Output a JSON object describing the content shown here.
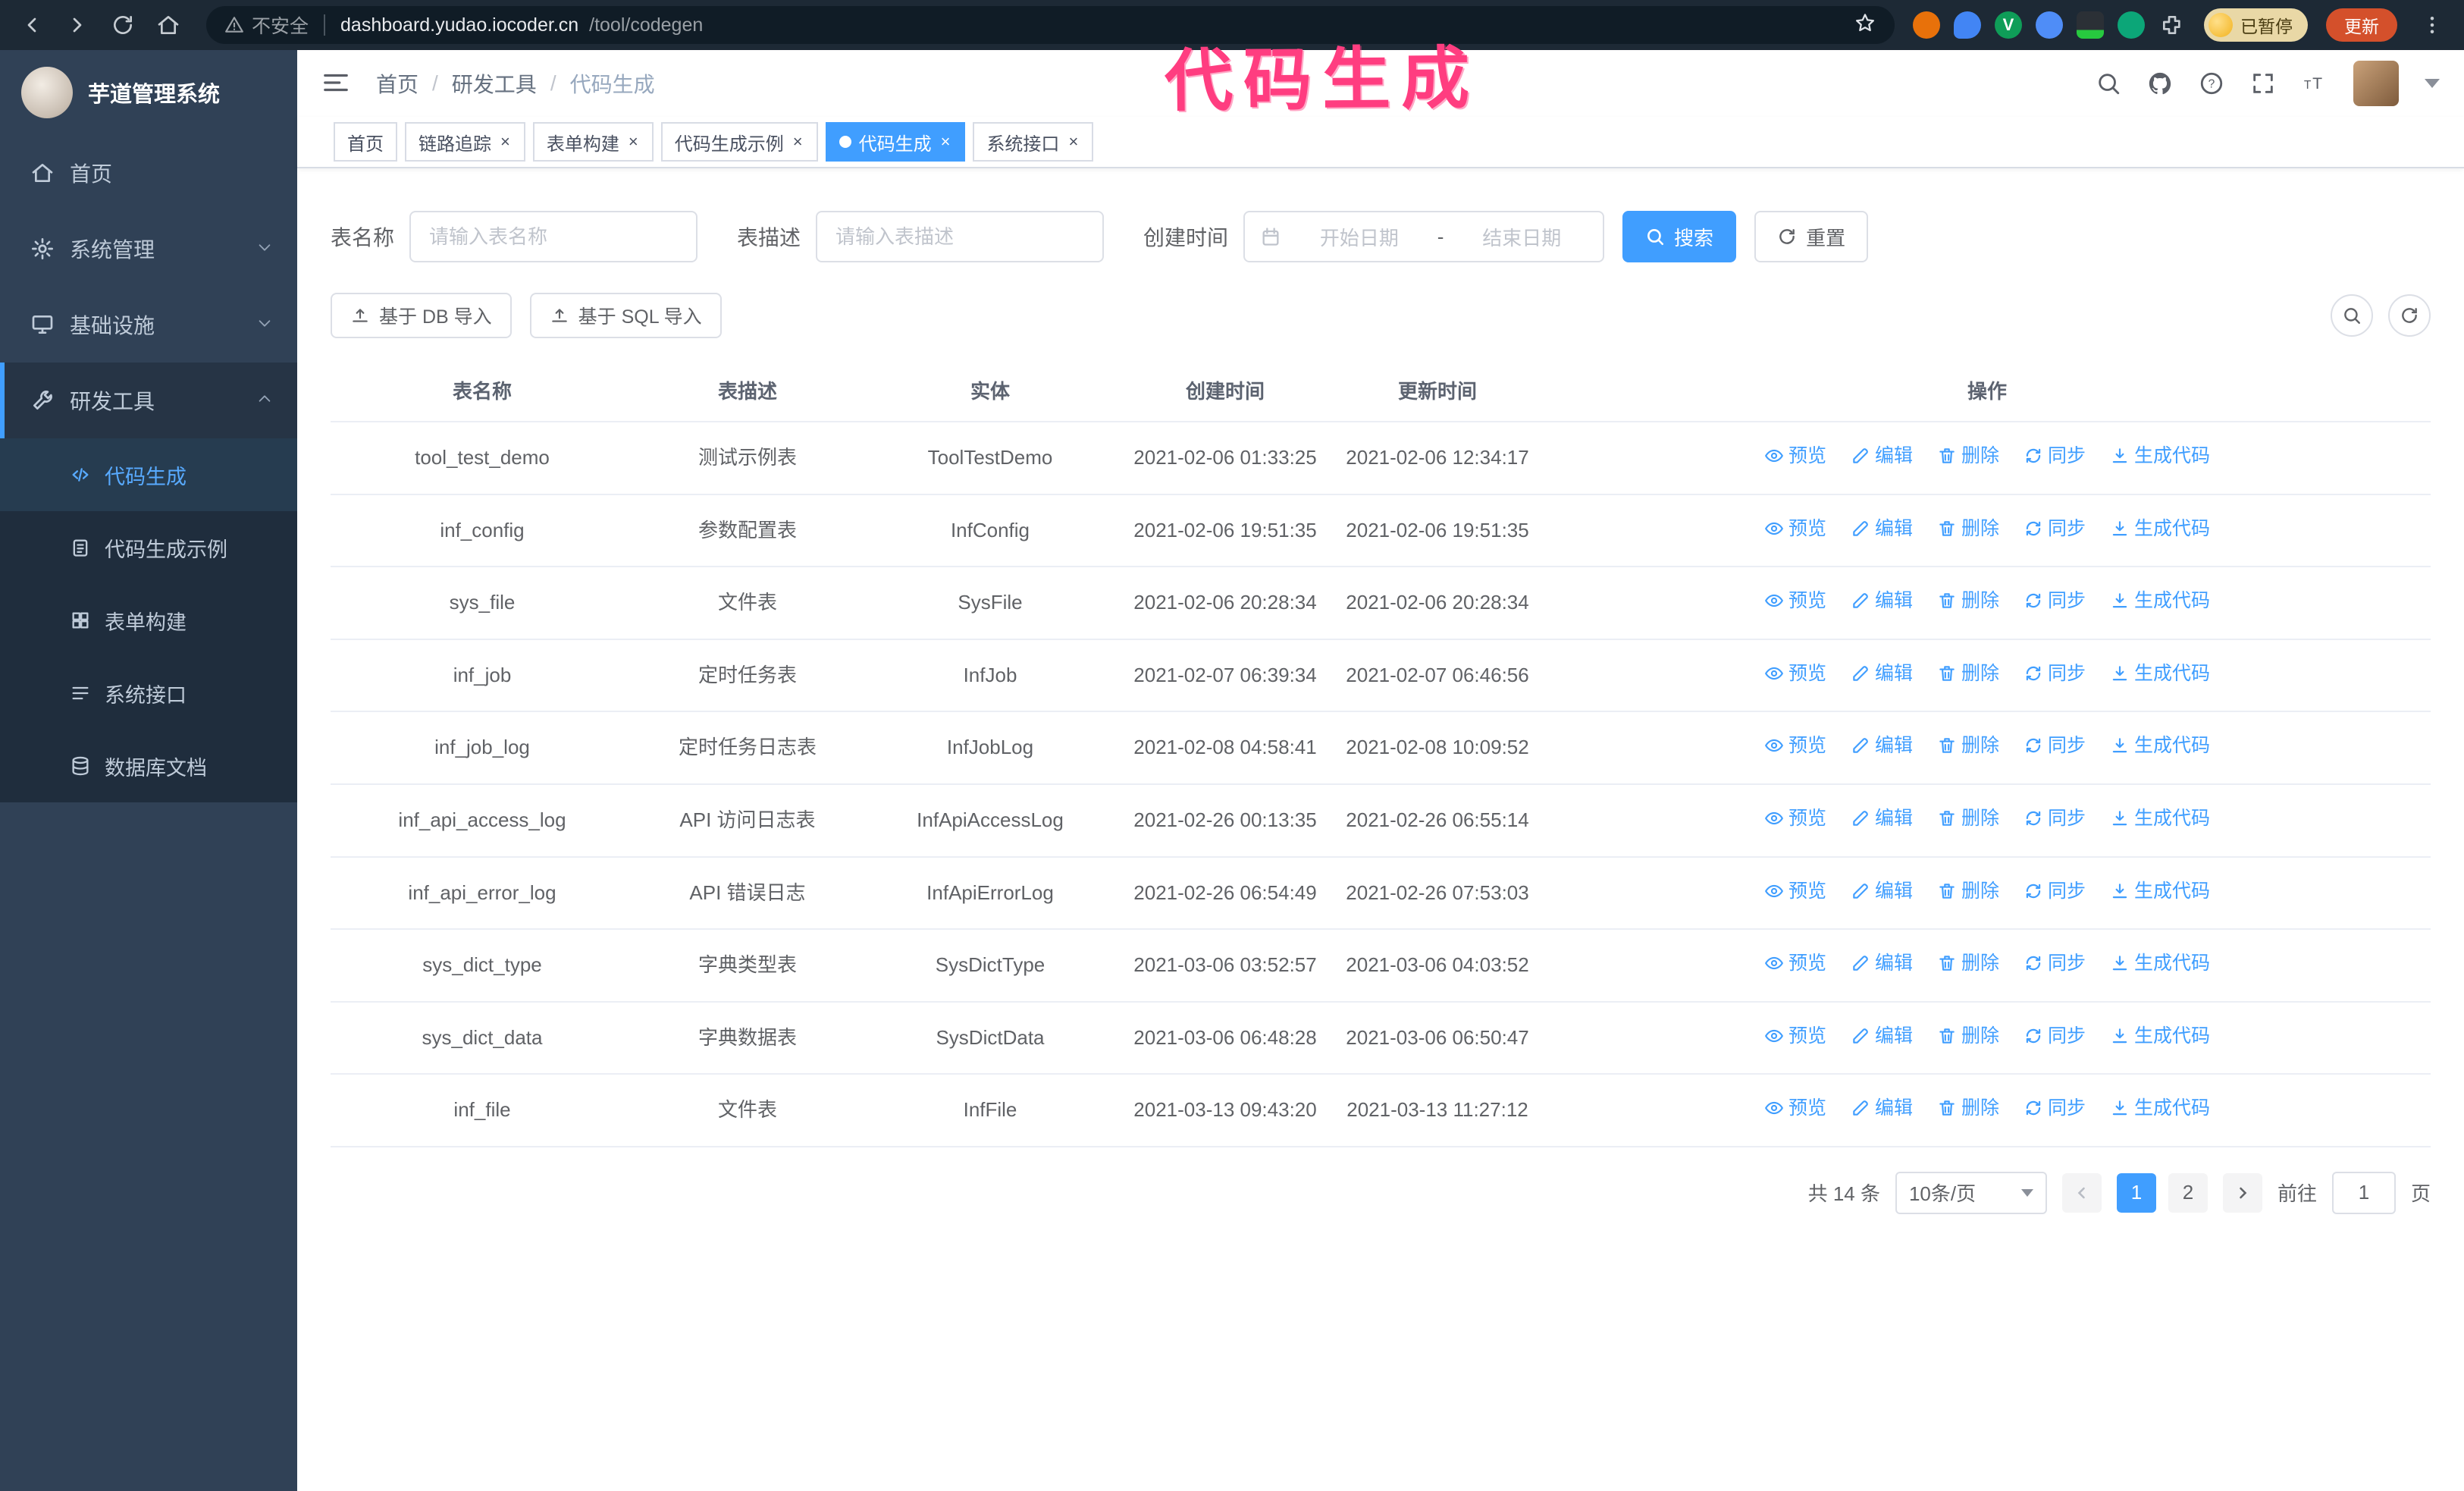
{
  "annotation": {
    "text": "代码生成",
    "color": "#ff3d80"
  },
  "browser": {
    "url_warning": "不安全",
    "url_host": "dashboard.yudao.iocoder.cn",
    "url_path": "/tool/codegen",
    "paused_badge": "已暂停",
    "update_button": "更新"
  },
  "sidebar": {
    "logo_title": "芋道管理系统",
    "items": [
      {
        "key": "home",
        "label": "首页",
        "icon": "home-icon"
      },
      {
        "key": "system",
        "label": "系统管理",
        "icon": "gear-icon",
        "expandable": true
      },
      {
        "key": "infra",
        "label": "基础设施",
        "icon": "monitor-icon",
        "expandable": true
      },
      {
        "key": "devtools",
        "label": "研发工具",
        "icon": "wrench-icon",
        "expanded": true,
        "children": [
          {
            "key": "codegen",
            "label": "代码生成",
            "icon": "code-icon",
            "active": true
          },
          {
            "key": "codegen-example",
            "label": "代码生成示例",
            "icon": "clipboard-icon"
          },
          {
            "key": "form-build",
            "label": "表单构建",
            "icon": "grid-icon"
          },
          {
            "key": "api",
            "label": "系统接口",
            "icon": "list-icon"
          },
          {
            "key": "db-doc",
            "label": "数据库文档",
            "icon": "database-icon"
          }
        ]
      }
    ]
  },
  "header": {
    "breadcrumb": [
      "首页",
      "研发工具",
      "代码生成"
    ],
    "breadcrumb_separator": "/"
  },
  "tabs": [
    {
      "key": "home",
      "label": "首页",
      "closable": false
    },
    {
      "key": "trace",
      "label": "链路追踪",
      "closable": true
    },
    {
      "key": "form-build",
      "label": "表单构建",
      "closable": true
    },
    {
      "key": "codegen-example",
      "label": "代码生成示例",
      "closable": true
    },
    {
      "key": "codegen",
      "label": "代码生成",
      "closable": true,
      "active": true
    },
    {
      "key": "api",
      "label": "系统接口",
      "closable": true
    }
  ],
  "filters": {
    "table_name_label": "表名称",
    "table_name_placeholder": "请输入表名称",
    "table_desc_label": "表描述",
    "table_desc_placeholder": "请输入表描述",
    "create_time_label": "创建时间",
    "date_start_placeholder": "开始日期",
    "date_separator": "-",
    "date_end_placeholder": "结束日期",
    "search_button": "搜索",
    "reset_button": "重置"
  },
  "toolbar": {
    "import_db": "基于 DB 导入",
    "import_sql": "基于 SQL 导入"
  },
  "table": {
    "columns": [
      "表名称",
      "表描述",
      "实体",
      "创建时间",
      "更新时间",
      "操作"
    ],
    "actions": [
      {
        "key": "preview",
        "label": "预览",
        "icon": "eye-icon"
      },
      {
        "key": "edit",
        "label": "编辑",
        "icon": "pencil-icon"
      },
      {
        "key": "delete",
        "label": "删除",
        "icon": "trash-icon"
      },
      {
        "key": "sync",
        "label": "同步",
        "icon": "sync-icon"
      },
      {
        "key": "generate",
        "label": "生成代码",
        "icon": "download-icon"
      }
    ],
    "rows": [
      [
        "tool_test_demo",
        "测试示例表",
        "ToolTestDemo",
        "2021-02-06 01:33:25",
        "2021-02-06 12:34:17"
      ],
      [
        "inf_config",
        "参数配置表",
        "InfConfig",
        "2021-02-06 19:51:35",
        "2021-02-06 19:51:35"
      ],
      [
        "sys_file",
        "文件表",
        "SysFile",
        "2021-02-06 20:28:34",
        "2021-02-06 20:28:34"
      ],
      [
        "inf_job",
        "定时任务表",
        "InfJob",
        "2021-02-07 06:39:34",
        "2021-02-07 06:46:56"
      ],
      [
        "inf_job_log",
        "定时任务日志表",
        "InfJobLog",
        "2021-02-08 04:58:41",
        "2021-02-08 10:09:52"
      ],
      [
        "inf_api_access_log",
        "API 访问日志表",
        "InfApiAccessLog",
        "2021-02-26 00:13:35",
        "2021-02-26 06:55:14"
      ],
      [
        "inf_api_error_log",
        "API 错误日志",
        "InfApiErrorLog",
        "2021-02-26 06:54:49",
        "2021-02-26 07:53:03"
      ],
      [
        "sys_dict_type",
        "字典类型表",
        "SysDictType",
        "2021-03-06 03:52:57",
        "2021-03-06 04:03:52"
      ],
      [
        "sys_dict_data",
        "字典数据表",
        "SysDictData",
        "2021-03-06 06:48:28",
        "2021-03-06 06:50:47"
      ],
      [
        "inf_file",
        "文件表",
        "InfFile",
        "2021-03-13 09:43:20",
        "2021-03-13 11:27:12"
      ]
    ]
  },
  "pagination": {
    "total": "共 14 条",
    "page_size": "10条/页",
    "pages": [
      "1",
      "2"
    ],
    "active_page": "1",
    "goto_label": "前往",
    "goto_value": "1",
    "goto_suffix": "页"
  },
  "colors": {
    "accent": "#409eff",
    "sidebar_bg": "#304156",
    "chrome_bg": "#1d2935"
  }
}
